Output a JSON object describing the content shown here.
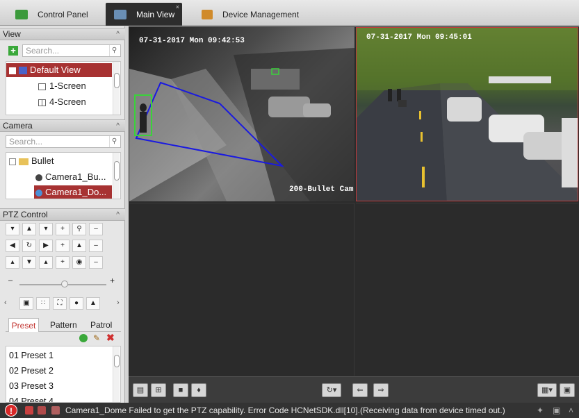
{
  "tabs": [
    {
      "label": "Control Panel",
      "icon": "control-panel-icon"
    },
    {
      "label": "Main View",
      "icon": "main-view-icon",
      "active": true,
      "close": "×"
    },
    {
      "label": "Device Management",
      "icon": "device-management-icon"
    }
  ],
  "view_section": {
    "title": "View",
    "search_placeholder": "Search...",
    "items": [
      "Default View",
      "1-Screen",
      "4-Screen"
    ]
  },
  "camera_section": {
    "title": "Camera",
    "search_placeholder": "Search...",
    "group": "Bullet",
    "items": [
      "Camera1_Bu...",
      "Camera1_Do..."
    ]
  },
  "ptz": {
    "title": "PTZ Control",
    "tabs": [
      "Preset",
      "Pattern",
      "Patrol"
    ],
    "presets": [
      "01  Preset 1",
      "02  Preset 2",
      "03  Preset 3",
      "04  Preset 4"
    ]
  },
  "video": {
    "cam1_timestamp": "07-31-2017 Mon 09:42:53",
    "cam1_label": "200-Bullet Cam",
    "cam2_timestamp": "07-31-2017 Mon 09:45:01"
  },
  "status": {
    "message": "Camera1_Dome Failed to get the PTZ capability. Error Code HCNetSDK.dll[10].(Receiving data from device timed out.)"
  },
  "colors": {
    "accent": "#a73232",
    "dark": "#2b2b2b"
  }
}
